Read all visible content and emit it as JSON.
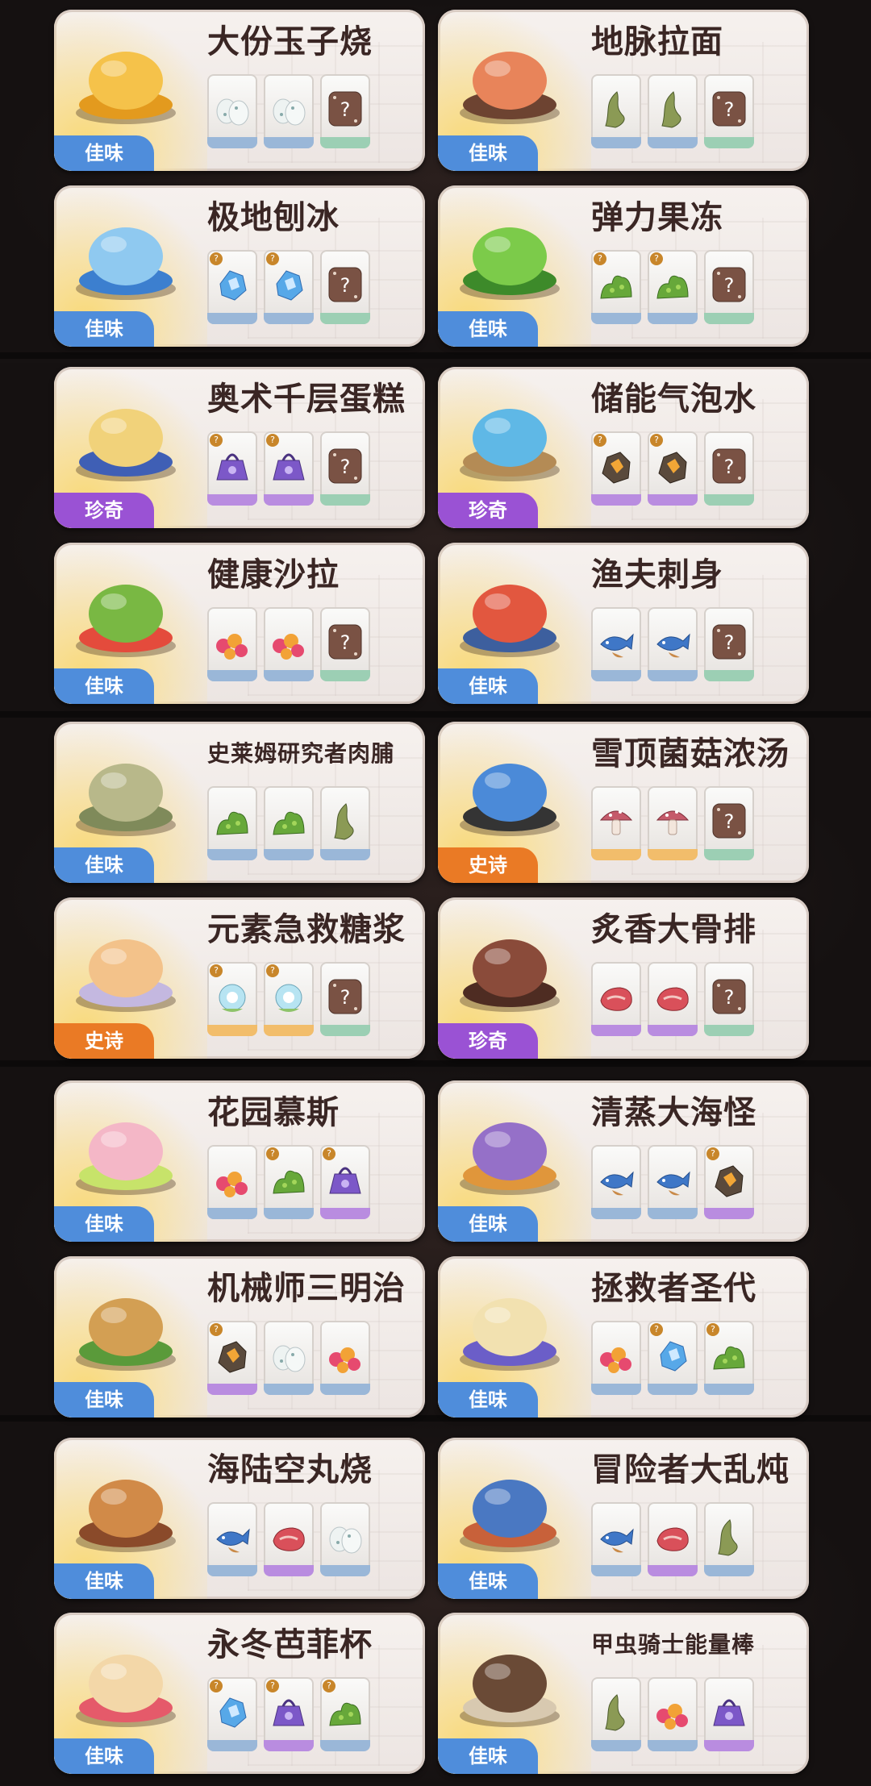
{
  "cards": [
    {
      "name": "大份玉子烧",
      "badge": "佳味",
      "rarity": "jiawei",
      "dish": "egg-roll-dish-icon",
      "ingredients": [
        {
          "icon": "egg-icon",
          "tier": "blue"
        },
        {
          "icon": "egg-icon",
          "tier": "blue"
        },
        {
          "icon": "dice-icon",
          "tier": "green"
        }
      ]
    },
    {
      "name": "地脉拉面",
      "badge": "佳味",
      "rarity": "jiawei",
      "dish": "ramen-dish-icon",
      "ingredients": [
        {
          "icon": "herb-icon",
          "tier": "blue"
        },
        {
          "icon": "herb-icon",
          "tier": "blue"
        },
        {
          "icon": "dice-icon",
          "tier": "green"
        }
      ]
    },
    {
      "name": "极地刨冰",
      "badge": "佳味",
      "rarity": "jiawei",
      "dish": "shaved-ice-dish-icon",
      "ingredients": [
        {
          "icon": "ice-crystal-icon",
          "tier": "blue",
          "q": true
        },
        {
          "icon": "ice-crystal-icon",
          "tier": "blue",
          "q": true
        },
        {
          "icon": "dice-icon",
          "tier": "green"
        }
      ]
    },
    {
      "name": "弹力果冻",
      "badge": "佳味",
      "rarity": "jiawei",
      "dish": "jelly-dish-icon",
      "ingredients": [
        {
          "icon": "moss-icon",
          "tier": "blue",
          "q": true
        },
        {
          "icon": "moss-icon",
          "tier": "blue",
          "q": true
        },
        {
          "icon": "dice-icon",
          "tier": "green"
        }
      ]
    },
    {
      "name": "奥术千层蛋糕",
      "badge": "珍奇",
      "rarity": "zhenqi",
      "dish": "cake-dish-icon",
      "ingredients": [
        {
          "icon": "purple-pouch-icon",
          "tier": "purple",
          "q": true
        },
        {
          "icon": "purple-pouch-icon",
          "tier": "purple",
          "q": true
        },
        {
          "icon": "dice-icon",
          "tier": "green"
        }
      ]
    },
    {
      "name": "储能气泡水",
      "badge": "珍奇",
      "rarity": "zhenqi",
      "dish": "potion-bottle-dish-icon",
      "ingredients": [
        {
          "icon": "amber-ore-icon",
          "tier": "purple",
          "q": true
        },
        {
          "icon": "amber-ore-icon",
          "tier": "purple",
          "q": true
        },
        {
          "icon": "dice-icon",
          "tier": "green"
        }
      ]
    },
    {
      "name": "健康沙拉",
      "badge": "佳味",
      "rarity": "jiawei",
      "dish": "salad-dish-icon",
      "ingredients": [
        {
          "icon": "berries-icon",
          "tier": "blue"
        },
        {
          "icon": "berries-icon",
          "tier": "blue"
        },
        {
          "icon": "dice-icon",
          "tier": "green"
        }
      ]
    },
    {
      "name": "渔夫刺身",
      "badge": "佳味",
      "rarity": "jiawei",
      "dish": "sashimi-dish-icon",
      "ingredients": [
        {
          "icon": "fish-icon",
          "tier": "blue"
        },
        {
          "icon": "fish-icon",
          "tier": "blue"
        },
        {
          "icon": "dice-icon",
          "tier": "green"
        }
      ]
    },
    {
      "name": "史莱姆研究者肉脯",
      "badge": "佳味",
      "rarity": "jiawei",
      "dish": "jerky-dish-icon",
      "ingredients": [
        {
          "icon": "moss-icon",
          "tier": "blue"
        },
        {
          "icon": "moss-icon",
          "tier": "blue"
        },
        {
          "icon": "herb-icon",
          "tier": "blue"
        }
      ]
    },
    {
      "name": "雪顶菌菇浓汤",
      "badge": "史诗",
      "rarity": "shishi",
      "dish": "mushroom-soup-dish-icon",
      "ingredients": [
        {
          "icon": "mushroom-icon",
          "tier": "orange"
        },
        {
          "icon": "mushroom-icon",
          "tier": "orange"
        },
        {
          "icon": "dice-icon",
          "tier": "green"
        }
      ]
    },
    {
      "name": "元素急救糖浆",
      "badge": "史诗",
      "rarity": "shishi",
      "dish": "syrup-glass-dish-icon",
      "ingredients": [
        {
          "icon": "crystal-flower-icon",
          "tier": "orange",
          "q": true
        },
        {
          "icon": "crystal-flower-icon",
          "tier": "orange",
          "q": true
        },
        {
          "icon": "dice-icon",
          "tier": "green"
        }
      ]
    },
    {
      "name": "炙香大骨排",
      "badge": "珍奇",
      "rarity": "zhenqi",
      "dish": "ribs-dish-icon",
      "ingredients": [
        {
          "icon": "meat-icon",
          "tier": "purple"
        },
        {
          "icon": "meat-icon",
          "tier": "purple"
        },
        {
          "icon": "dice-icon",
          "tier": "green"
        }
      ]
    },
    {
      "name": "花园慕斯",
      "badge": "佳味",
      "rarity": "jiawei",
      "dish": "mousse-cake-dish-icon",
      "ingredients": [
        {
          "icon": "berries-icon",
          "tier": "blue"
        },
        {
          "icon": "moss-icon",
          "tier": "blue",
          "q": true
        },
        {
          "icon": "purple-pouch-icon",
          "tier": "purple",
          "q": true
        }
      ]
    },
    {
      "name": "清蒸大海怪",
      "badge": "佳味",
      "rarity": "jiawei",
      "dish": "octopus-dish-icon",
      "ingredients": [
        {
          "icon": "fish-icon",
          "tier": "blue"
        },
        {
          "icon": "fish-icon",
          "tier": "blue"
        },
        {
          "icon": "amber-ore-icon",
          "tier": "purple",
          "q": true
        }
      ]
    },
    {
      "name": "机械师三明治",
      "badge": "佳味",
      "rarity": "jiawei",
      "dish": "sandwich-dish-icon",
      "ingredients": [
        {
          "icon": "amber-ore-icon",
          "tier": "purple",
          "q": true
        },
        {
          "icon": "egg-icon",
          "tier": "blue"
        },
        {
          "icon": "berries-icon",
          "tier": "blue"
        }
      ]
    },
    {
      "name": "拯救者圣代",
      "badge": "佳味",
      "rarity": "jiawei",
      "dish": "sundae-dish-icon",
      "ingredients": [
        {
          "icon": "berries-icon",
          "tier": "blue"
        },
        {
          "icon": "ice-crystal-icon",
          "tier": "blue",
          "q": true
        },
        {
          "icon": "moss-icon",
          "tier": "blue",
          "q": true
        }
      ]
    },
    {
      "name": "海陆空丸烧",
      "badge": "佳味",
      "rarity": "jiawei",
      "dish": "skewer-dish-icon",
      "ingredients": [
        {
          "icon": "fish-icon",
          "tier": "blue"
        },
        {
          "icon": "meat-icon",
          "tier": "purple"
        },
        {
          "icon": "egg-icon",
          "tier": "blue"
        }
      ]
    },
    {
      "name": "冒险者大乱炖",
      "badge": "佳味",
      "rarity": "jiawei",
      "dish": "stew-dish-icon",
      "ingredients": [
        {
          "icon": "fish-icon",
          "tier": "blue"
        },
        {
          "icon": "meat-icon",
          "tier": "purple"
        },
        {
          "icon": "herb-icon",
          "tier": "blue"
        }
      ]
    },
    {
      "name": "永冬芭菲杯",
      "badge": "佳味",
      "rarity": "jiawei",
      "dish": "parfait-dish-icon",
      "ingredients": [
        {
          "icon": "ice-crystal-icon",
          "tier": "blue",
          "q": true
        },
        {
          "icon": "purple-pouch-icon",
          "tier": "purple",
          "q": true
        },
        {
          "icon": "moss-icon",
          "tier": "blue",
          "q": true
        }
      ]
    },
    {
      "name": "甲虫骑士能量棒",
      "badge": "佳味",
      "rarity": "jiawei",
      "dish": "energy-bar-dish-icon",
      "ingredients": [
        {
          "icon": "herb-icon",
          "tier": "blue"
        },
        {
          "icon": "berries-icon",
          "tier": "blue"
        },
        {
          "icon": "purple-pouch-icon",
          "tier": "purple"
        }
      ]
    }
  ],
  "question_mark": "?"
}
